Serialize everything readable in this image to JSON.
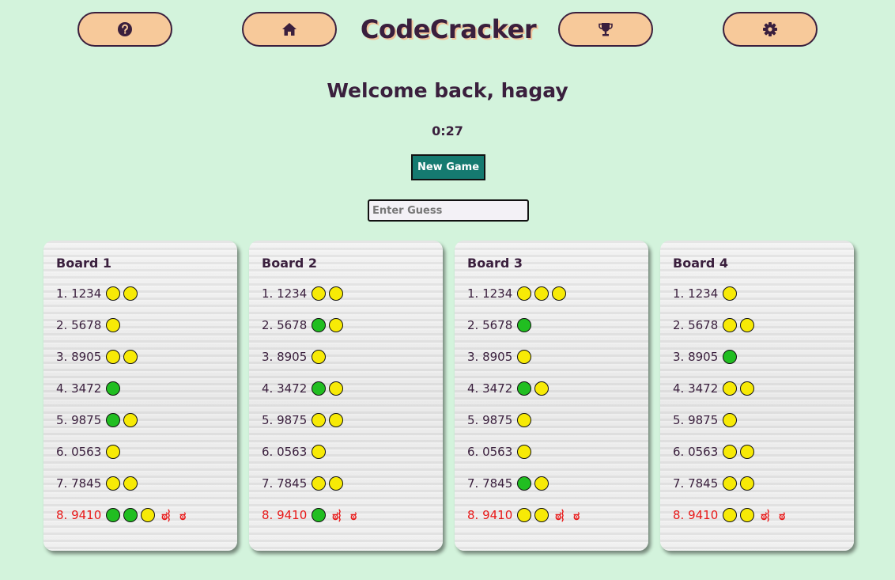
{
  "header": {
    "logo": "CodeCracker",
    "nav": [
      {
        "name": "help-button",
        "icon": "question-circle-icon"
      },
      {
        "name": "home-button",
        "icon": "home-icon"
      },
      {
        "name": "leaderboard-button",
        "icon": "trophy-icon"
      },
      {
        "name": "settings-button",
        "icon": "gear-icon"
      }
    ]
  },
  "welcome": "Welcome back, hagay",
  "timer": "0:27",
  "new_game_label": "New Game",
  "guess_input": {
    "placeholder": "Enter Guess",
    "value": ""
  },
  "colors": {
    "background": "#d3f3dc",
    "accent": "#157a70",
    "nav_button": "#f7c99a",
    "text": "#3a1f3d",
    "solved": "#e81818",
    "peg_yellow": "#f7ea06",
    "peg_green": "#21be21"
  },
  "boards": [
    {
      "title": "Board 1",
      "rows": [
        {
          "label": "1. 1234",
          "pegs": [
            "y",
            "y"
          ]
        },
        {
          "label": "2. 5678",
          "pegs": [
            "y"
          ]
        },
        {
          "label": "3. 8905",
          "pegs": [
            "y",
            "y"
          ]
        },
        {
          "label": "4. 3472",
          "pegs": [
            "g"
          ]
        },
        {
          "label": "5. 9875",
          "pegs": [
            "g",
            "y"
          ]
        },
        {
          "label": "6. 0563",
          "pegs": [
            "y"
          ]
        },
        {
          "label": "7. 7845",
          "pegs": [
            "y",
            "y"
          ]
        },
        {
          "label": "8. 9410",
          "pegs": [
            "g",
            "g",
            "y"
          ],
          "solved": true,
          "mark": "ಠ︴ಠ"
        }
      ]
    },
    {
      "title": "Board 2",
      "rows": [
        {
          "label": "1. 1234",
          "pegs": [
            "y",
            "y"
          ]
        },
        {
          "label": "2. 5678",
          "pegs": [
            "g",
            "y"
          ]
        },
        {
          "label": "3. 8905",
          "pegs": [
            "y"
          ]
        },
        {
          "label": "4. 3472",
          "pegs": [
            "g",
            "y"
          ]
        },
        {
          "label": "5. 9875",
          "pegs": [
            "y",
            "y"
          ]
        },
        {
          "label": "6. 0563",
          "pegs": [
            "y"
          ]
        },
        {
          "label": "7. 7845",
          "pegs": [
            "y",
            "y"
          ]
        },
        {
          "label": "8. 9410",
          "pegs": [
            "g"
          ],
          "solved": true,
          "mark": "ಠ︴ಠ"
        }
      ]
    },
    {
      "title": "Board 3",
      "rows": [
        {
          "label": "1. 1234",
          "pegs": [
            "y",
            "y",
            "y"
          ]
        },
        {
          "label": "2. 5678",
          "pegs": [
            "g"
          ]
        },
        {
          "label": "3. 8905",
          "pegs": [
            "y"
          ]
        },
        {
          "label": "4. 3472",
          "pegs": [
            "g",
            "y"
          ]
        },
        {
          "label": "5. 9875",
          "pegs": [
            "y"
          ]
        },
        {
          "label": "6. 0563",
          "pegs": [
            "y"
          ]
        },
        {
          "label": "7. 7845",
          "pegs": [
            "g",
            "y"
          ]
        },
        {
          "label": "8. 9410",
          "pegs": [
            "y",
            "y"
          ],
          "solved": true,
          "mark": "ಠ︴ಠ"
        }
      ]
    },
    {
      "title": "Board 4",
      "rows": [
        {
          "label": "1. 1234",
          "pegs": [
            "y"
          ]
        },
        {
          "label": "2. 5678",
          "pegs": [
            "y",
            "y"
          ]
        },
        {
          "label": "3. 8905",
          "pegs": [
            "g"
          ]
        },
        {
          "label": "4. 3472",
          "pegs": [
            "y",
            "y"
          ]
        },
        {
          "label": "5. 9875",
          "pegs": [
            "y"
          ]
        },
        {
          "label": "6. 0563",
          "pegs": [
            "y",
            "y"
          ]
        },
        {
          "label": "7. 7845",
          "pegs": [
            "y",
            "y"
          ]
        },
        {
          "label": "8. 9410",
          "pegs": [
            "y",
            "y"
          ],
          "solved": true,
          "mark": "ಠ︴ಠ"
        }
      ]
    }
  ]
}
